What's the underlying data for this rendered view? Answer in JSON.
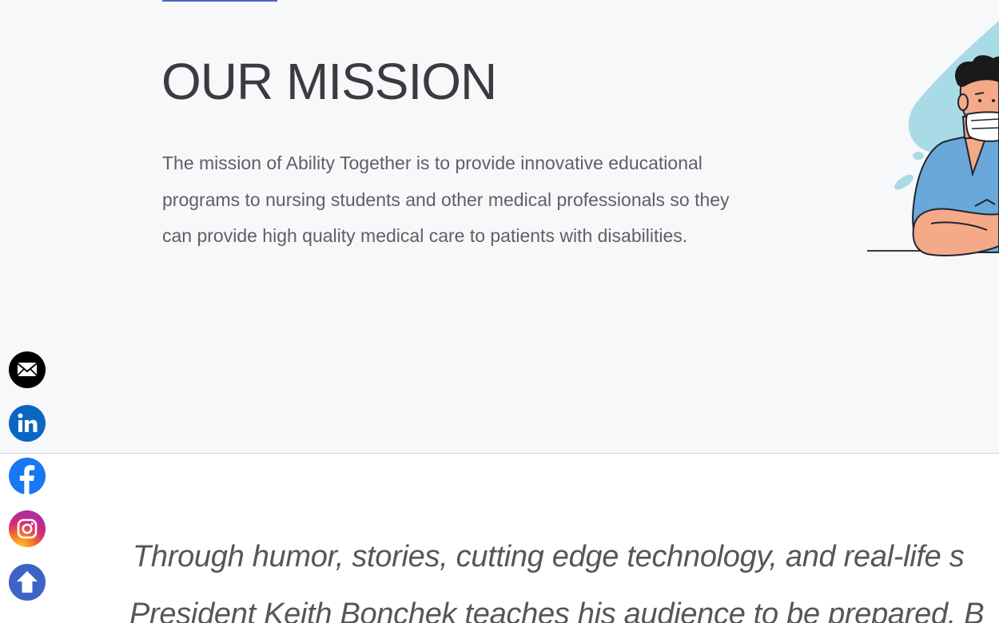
{
  "mission": {
    "title": "OUR MISSION",
    "text": "The mission of Ability Together is to provide innovative educational programs to nursing students and other medical professionals so they can provide high quality medical care to patients with disabilities."
  },
  "social": {
    "items": [
      {
        "name": "email",
        "icon": "email-icon",
        "color": "#000000"
      },
      {
        "name": "linkedin",
        "icon": "linkedin-icon",
        "color": "#0a66c2"
      },
      {
        "name": "facebook",
        "icon": "facebook-icon",
        "color": "#1877f2"
      },
      {
        "name": "instagram",
        "icon": "instagram-icon",
        "color": "#e1306c"
      },
      {
        "name": "scroll-top",
        "icon": "arrow-up-icon",
        "color": "#3d63c7"
      }
    ]
  },
  "quote": {
    "line1": "Through humor, stories, cutting edge technology, and real-life s",
    "line2": "President Keith Bonchek teaches his audience to be prepared. B"
  },
  "colors": {
    "accent": "#4a67c9",
    "section_bg": "#f7f8fa",
    "heading": "#3a3b3e",
    "body_text": "#5f6065"
  }
}
